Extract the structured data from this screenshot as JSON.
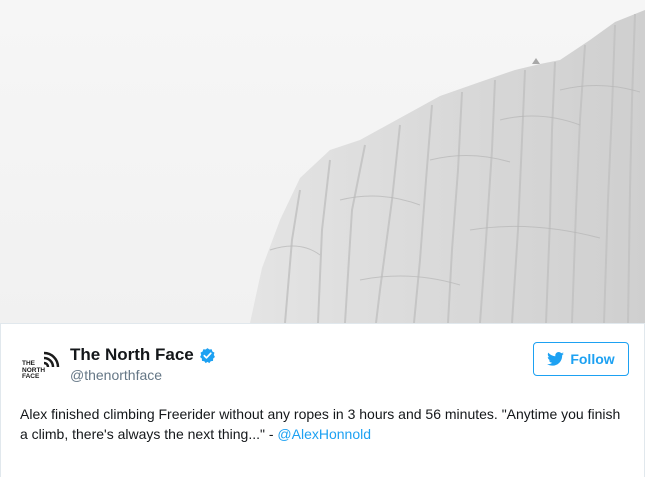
{
  "media": {
    "alt": "Rock face photo",
    "icon": "photo"
  },
  "account": {
    "logo_text": "THE NORTH FACE",
    "display_name": "The North Face",
    "handle": "@thenorthface",
    "verified": true
  },
  "follow_button": {
    "label": "Follow",
    "icon": "twitter-bird-icon"
  },
  "tweet": {
    "text": "Alex finished climbing Freerider without any ropes in 3 hours and 56 minutes. \"Anytime you finish a climb, there's always the next thing...\" - ",
    "mention": "@AlexHonnold"
  },
  "colors": {
    "accent": "#1da1f2",
    "text": "#14171a",
    "muted": "#657786",
    "border": "#e1e8ed"
  }
}
